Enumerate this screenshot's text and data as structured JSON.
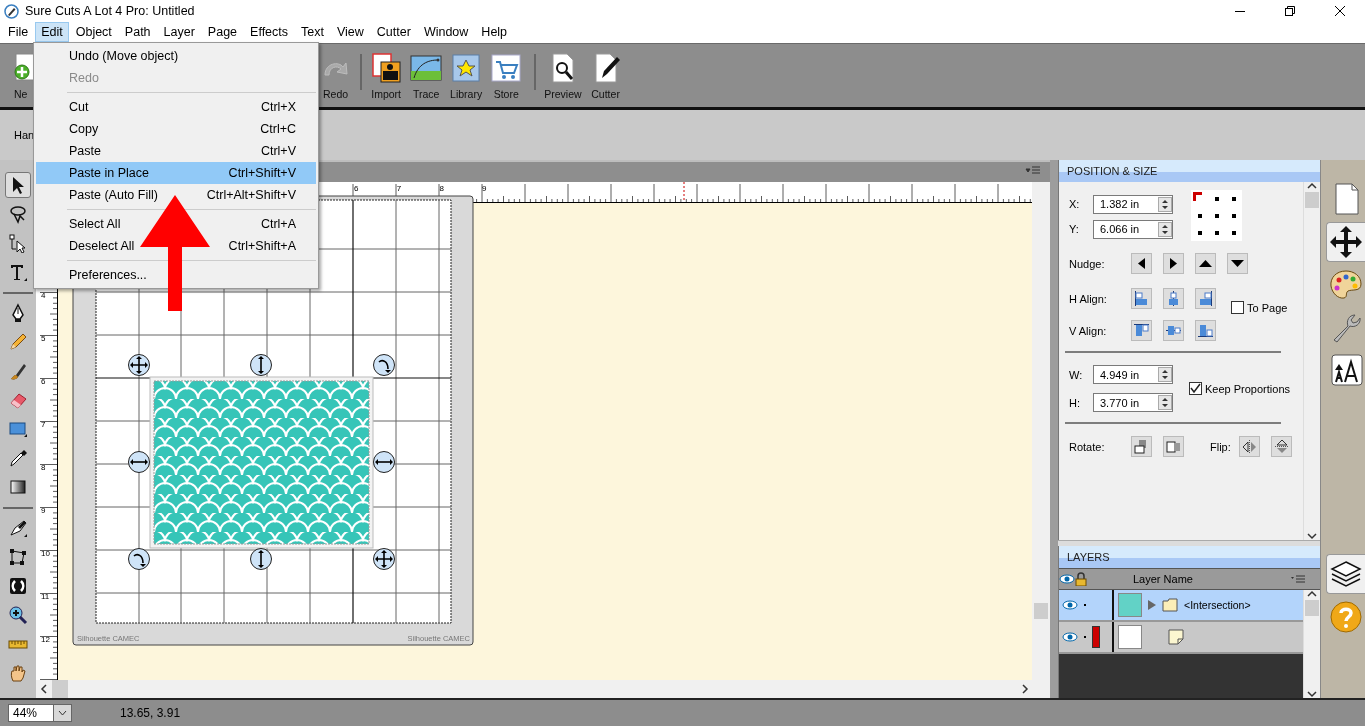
{
  "window": {
    "title": "Sure Cuts A Lot 4 Pro: Untitled"
  },
  "menu_bar": [
    {
      "label": "File",
      "selected": false
    },
    {
      "label": "Edit",
      "selected": true
    },
    {
      "label": "Object",
      "selected": false
    },
    {
      "label": "Path",
      "selected": false
    },
    {
      "label": "Layer",
      "selected": false
    },
    {
      "label": "Page",
      "selected": false
    },
    {
      "label": "Effects",
      "selected": false
    },
    {
      "label": "Text",
      "selected": false
    },
    {
      "label": "View",
      "selected": false
    },
    {
      "label": "Cutter",
      "selected": false
    },
    {
      "label": "Window",
      "selected": false
    },
    {
      "label": "Help",
      "selected": false
    }
  ],
  "edit_menu": [
    {
      "kind": "item",
      "label": "Undo (Move object)",
      "disabled": false,
      "selected": false
    },
    {
      "kind": "item",
      "label": "Redo",
      "disabled": true,
      "selected": false
    },
    {
      "kind": "separator"
    },
    {
      "kind": "item",
      "label": "Cut",
      "shortcut": "Ctrl+X",
      "disabled": false,
      "selected": false
    },
    {
      "kind": "item",
      "label": "Copy",
      "shortcut": "Ctrl+C",
      "disabled": false,
      "selected": false
    },
    {
      "kind": "item",
      "label": "Paste",
      "shortcut": "Ctrl+V",
      "disabled": false,
      "selected": false
    },
    {
      "kind": "item",
      "label": "Paste in Place",
      "shortcut": "Ctrl+Shift+V",
      "disabled": false,
      "selected": true
    },
    {
      "kind": "item",
      "label": "Paste (Auto Fill)",
      "shortcut": "Ctrl+Alt+Shift+V",
      "disabled": false,
      "selected": false
    },
    {
      "kind": "separator"
    },
    {
      "kind": "item",
      "label": "Select All",
      "shortcut": "Ctrl+A",
      "disabled": false,
      "selected": false
    },
    {
      "kind": "item",
      "label": "Deselect All",
      "shortcut": "Ctrl+Shift+A",
      "disabled": false,
      "selected": false
    },
    {
      "kind": "separator"
    },
    {
      "kind": "item",
      "label": "Preferences...",
      "disabled": false,
      "selected": false
    }
  ],
  "toolbar": [
    {
      "kind": "button",
      "label": "Ne",
      "disabled": false
    },
    {
      "kind": "button",
      "label": "Redo",
      "disabled": true
    },
    {
      "kind": "separator"
    },
    {
      "kind": "button",
      "label": "Import",
      "disabled": false
    },
    {
      "kind": "button",
      "label": "Trace",
      "disabled": false
    },
    {
      "kind": "button",
      "label": "Library",
      "disabled": false
    },
    {
      "kind": "button",
      "label": "Store",
      "disabled": false
    },
    {
      "kind": "separator"
    },
    {
      "kind": "button",
      "label": "Preview",
      "disabled": false
    },
    {
      "kind": "button",
      "label": "Cutter",
      "disabled": false
    }
  ],
  "options_bar": {
    "label": "Han"
  },
  "tools": [
    {
      "selected": true
    },
    {
      "selected": false
    },
    {
      "selected": false
    },
    {
      "selected": false
    },
    {
      "selected": false
    },
    {
      "selected": false
    },
    {
      "selected": false
    },
    {
      "selected": false
    },
    {
      "selected": false
    },
    {
      "selected": false
    },
    {
      "selected": false
    },
    {
      "selected": false
    },
    {
      "selected": false
    },
    {
      "selected": false
    },
    {
      "selected": false
    },
    {
      "selected": false
    },
    {
      "selected": false
    }
  ],
  "canvas": {
    "top_ruler": [
      "6",
      "7",
      "8",
      "9"
    ],
    "left_ruler": [
      "4",
      "5",
      "6",
      "7",
      "8",
      "9",
      "10",
      "11",
      "12"
    ],
    "mat_labels": [
      "Silhouette CAMEC",
      "Silhouette CAMEC"
    ]
  },
  "position_size": {
    "title": "POSITION & SIZE",
    "x": {
      "label": "X:",
      "value": "1.382 in"
    },
    "y": {
      "label": "Y:",
      "value": "6.066 in"
    },
    "reference_points": [
      {
        "selected": true
      },
      {
        "selected": false
      },
      {
        "selected": false
      },
      {
        "selected": false
      },
      {
        "selected": false
      },
      {
        "selected": false
      },
      {
        "selected": false
      },
      {
        "selected": false
      },
      {
        "selected": false
      }
    ],
    "nudge_label": "Nudge:",
    "h_align_label": "H Align:",
    "v_align_label": "V Align:",
    "to_page": {
      "label": "To Page",
      "checked": false
    },
    "w": {
      "label": "W:",
      "value": "4.949 in"
    },
    "h": {
      "label": "H:",
      "value": "3.770 in"
    },
    "keep_proportions": {
      "label": "Keep Proportions",
      "checked": true
    },
    "rotate_label": "Rotate:",
    "flip_label": "Flip:"
  },
  "layers": {
    "title": "LAYERS",
    "column": "Layer Name",
    "rows": [
      {
        "kind": "group",
        "name": "<Intersection>",
        "selected": true
      },
      {
        "kind": "path",
        "selected": false,
        "color": "#cc0000"
      }
    ]
  },
  "panel_tabs_top": [
    {
      "selected": false
    },
    {
      "selected": true
    },
    {
      "selected": false
    },
    {
      "selected": false
    },
    {
      "selected": false
    }
  ],
  "panel_tabs_bottom": [
    {
      "selected": true
    },
    {
      "selected": false
    }
  ],
  "status_bar": {
    "zoom": "44%",
    "coordinates": "13.65, 3.91"
  }
}
